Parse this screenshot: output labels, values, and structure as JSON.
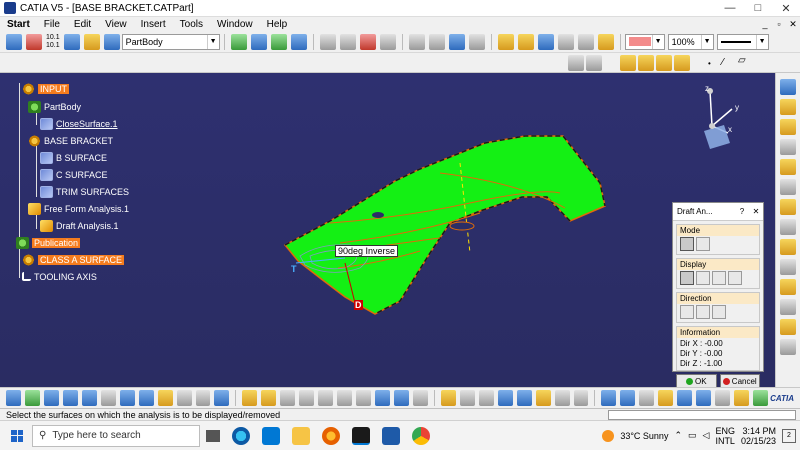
{
  "window": {
    "title": "CATIA V5 - [BASE BRACKET.CATPart]",
    "controls": [
      "—",
      "□",
      "✕"
    ]
  },
  "menu": {
    "items": [
      "Start",
      "File",
      "Edit",
      "View",
      "Insert",
      "Tools",
      "Window",
      "Help"
    ],
    "doc_controls": [
      "_",
      "▫",
      "✕"
    ]
  },
  "toolbar": {
    "workbench_combo": "PartBody",
    "zoom_combo": "100%",
    "scale_labels": [
      "10.1",
      "10.1"
    ]
  },
  "tree": {
    "nodes": [
      {
        "label": "INPUT",
        "icon": "gear-icon",
        "highlight": true
      },
      {
        "label": "PartBody",
        "icon": "partbody-icon"
      },
      {
        "label": "CloseSurface.1",
        "icon": "surface-icon",
        "underline": true
      },
      {
        "label": "BASE BRACKET",
        "icon": "gear-icon"
      },
      {
        "label": "B SURFACE",
        "icon": "surface-icon"
      },
      {
        "label": "C SURFACE",
        "icon": "surface-icon"
      },
      {
        "label": "TRIM SURFACES",
        "icon": "surface-icon"
      },
      {
        "label": "Free Form Analysis.1",
        "icon": "analysis-icon"
      },
      {
        "label": "Draft Analysis.1",
        "icon": "analysis-icon"
      },
      {
        "label": "Publication",
        "icon": "publication-icon",
        "highlight": true
      },
      {
        "label": "CLASS A SURFACE",
        "icon": "publication-icon",
        "highlight": true
      },
      {
        "label": "TOOLING AXIS",
        "icon": "axis-icon"
      }
    ]
  },
  "model": {
    "annotation": "90deg Inverse",
    "label_t": "T",
    "label_d": "D",
    "colors": {
      "surface": "#14f014",
      "edge": "#e06a0a",
      "background": "#2b2d66"
    }
  },
  "compass": {
    "axis_z": "z",
    "axis_y": "y",
    "axis_x": "x"
  },
  "dialog": {
    "title": "Draft An...",
    "help": "?",
    "close": "✕",
    "mode_label": "Mode",
    "display_label": "Display",
    "direction_label": "Direction",
    "information_label": "Information",
    "info": [
      "Dir X : -0.00",
      "Dir Y : -0.00",
      "Dir Z : -1.00"
    ],
    "ok_label": "OK",
    "cancel_label": "Cancel"
  },
  "right_logo": "CATIA",
  "status": {
    "message": "Select the surfaces on which the analysis is to be displayed/removed"
  },
  "taskbar": {
    "search_placeholder": "Type here to search",
    "weather": "33°C  Sunny",
    "lang_top": "ENG",
    "lang_bottom": "INTL",
    "time": "3:14 PM",
    "date": "02/15/23",
    "notif_count": "2"
  }
}
